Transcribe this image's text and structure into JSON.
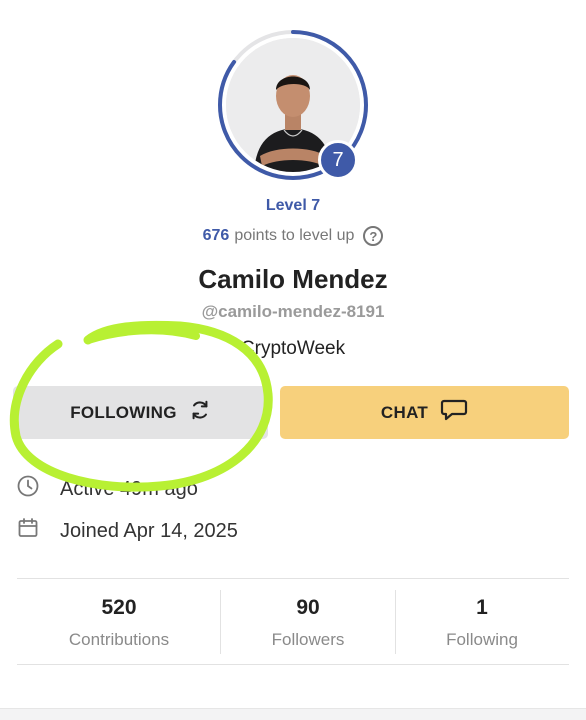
{
  "profile": {
    "level_badge": "7",
    "level_text": "Level 7",
    "points_value": "676",
    "points_suffix": "points to level up",
    "help_glyph": "?",
    "name": "Camilo Mendez",
    "username": "@camilo-mendez-8191",
    "tagline": "CryptoWeek",
    "level_progress": 0.85
  },
  "actions": {
    "following_label": "FOLLOWING",
    "chat_label": "CHAT"
  },
  "info": {
    "active": "Active 49m ago",
    "joined": "Joined Apr 14, 2025"
  },
  "stats": [
    {
      "value": "520",
      "label": "Contributions"
    },
    {
      "value": "90",
      "label": "Followers"
    },
    {
      "value": "1",
      "label": "Following"
    }
  ],
  "colors": {
    "accent": "#3f5aa8",
    "chat_button": "#f7d07c",
    "following_button": "#e3e3e4",
    "highlight_marker": "#b8f033"
  },
  "icons": [
    "help-icon",
    "refresh-icon",
    "chat-bubble-icon",
    "clock-icon",
    "calendar-icon"
  ]
}
